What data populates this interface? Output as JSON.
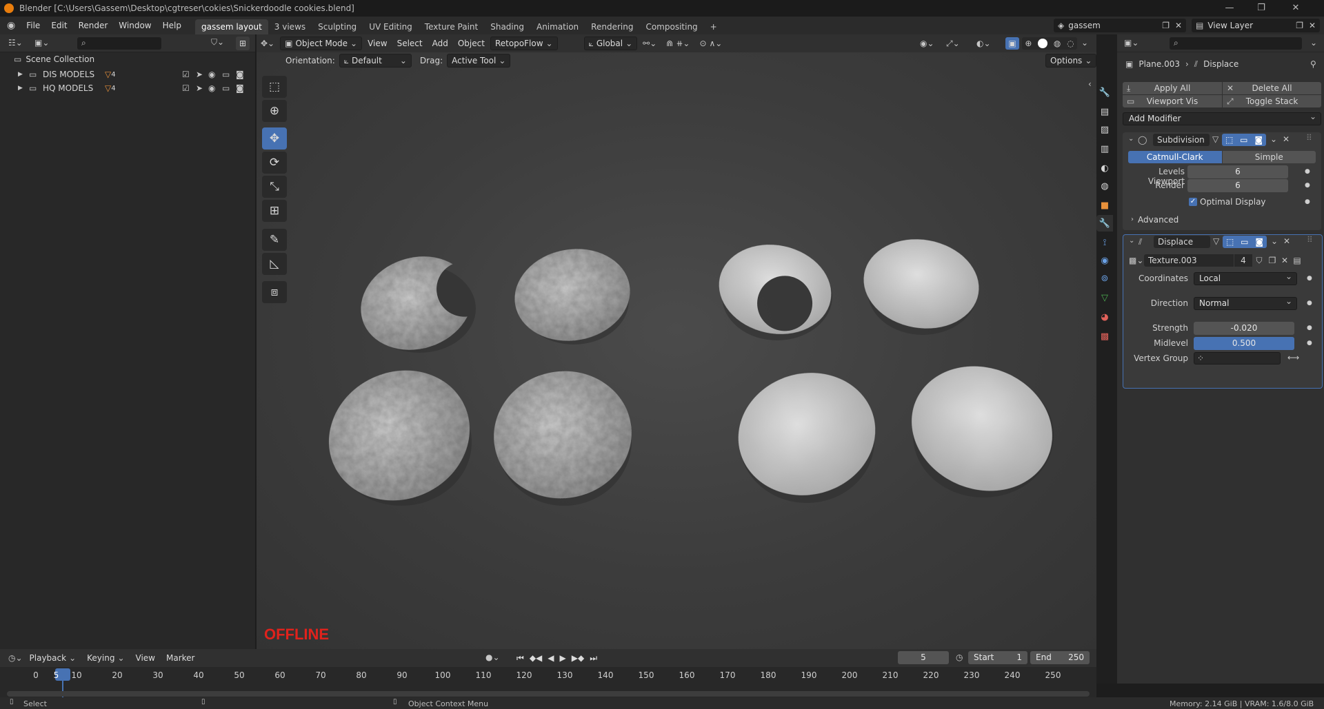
{
  "window": {
    "title": "Blender [C:\\Users\\Gassem\\Desktop\\cgtreser\\cokies\\Snickerdoodle cookies.blend]",
    "minimize": "—",
    "maximize": "❐",
    "close": "✕"
  },
  "menu": {
    "items": [
      "File",
      "Edit",
      "Render",
      "Window",
      "Help"
    ],
    "workspaces": [
      "gassem layout",
      "3 views",
      "Sculpting",
      "UV Editing",
      "Texture Paint",
      "Shading",
      "Animation",
      "Rendering",
      "Compositing"
    ],
    "active_workspace": "gassem layout",
    "add_tab": "+",
    "scene_name": "gassem",
    "view_layer": "View Layer"
  },
  "outliner": {
    "search_placeholder": "",
    "root": "Scene Collection",
    "items": [
      {
        "name": "DIS MODELS",
        "badge": "4"
      },
      {
        "name": "HQ MODELS",
        "badge": "4"
      }
    ]
  },
  "viewport": {
    "mode": "Object Mode",
    "menus": [
      "View",
      "Select",
      "Add",
      "Object"
    ],
    "addon": "RetopoFlow",
    "transform_orientation": "Global",
    "orientation_label": "Orientation:",
    "orientation_value": "Default",
    "drag_label": "Drag:",
    "drag_value": "Active Tool",
    "options": "Options",
    "overlay_text": "OFFLINE",
    "cookie_count": 8
  },
  "properties": {
    "search_placeholder": "",
    "breadcrumb_object": "Plane.003",
    "breadcrumb_modifier": "Displace",
    "apply_all": "Apply All",
    "delete_all": "Delete All",
    "viewport_vis": "Viewport Vis",
    "toggle_stack": "Toggle Stack",
    "add_modifier": "Add Modifier",
    "subdivision": {
      "name": "Subdivision",
      "tab_catmull": "Catmull-Clark",
      "tab_simple": "Simple",
      "levels_viewport_label": "Levels Viewport",
      "levels_viewport": "6",
      "render_label": "Render",
      "render": "6",
      "optimal_display": "Optimal Display",
      "advanced": "Advanced"
    },
    "displace": {
      "name": "Displace",
      "texture": "Texture.003",
      "texture_users": "4",
      "coordinates_label": "Coordinates",
      "coordinates": "Local",
      "direction_label": "Direction",
      "direction": "Normal",
      "strength_label": "Strength",
      "strength": "-0.020",
      "midlevel_label": "Midlevel",
      "midlevel": "0.500",
      "midlevel_fraction": 0.5,
      "vertex_group_label": "Vertex Group"
    }
  },
  "timeline": {
    "menus": [
      "Playback",
      "Keying",
      "View",
      "Marker"
    ],
    "current_frame": "5",
    "start_label": "Start",
    "start": "1",
    "end_label": "End",
    "end": "250",
    "ticks": [
      "0",
      "5",
      "10",
      "20",
      "30",
      "40",
      "50",
      "60",
      "70",
      "80",
      "90",
      "100",
      "110",
      "120",
      "130",
      "140",
      "150",
      "160",
      "170",
      "180",
      "190",
      "200",
      "210",
      "220",
      "230",
      "240",
      "250"
    ]
  },
  "statusbar": {
    "select": "Select",
    "context_menu": "Object Context Menu",
    "memory": "Memory: 2.14 GiB | VRAM: 1.6/8.0 GiB"
  },
  "colors": {
    "accent": "#4772b3",
    "offline": "#e0221c",
    "orange": "#e87d0d"
  }
}
